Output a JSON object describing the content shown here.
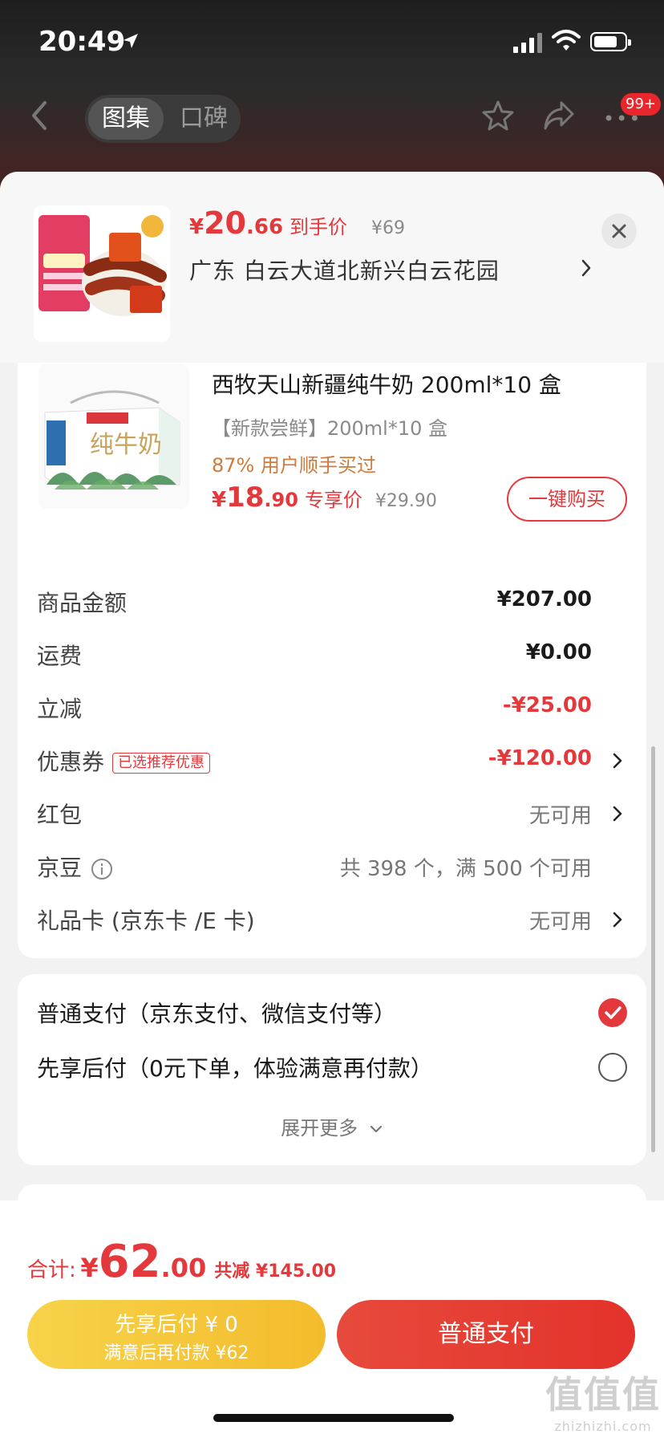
{
  "status_bar": {
    "time": "20:49"
  },
  "nav": {
    "tabs": [
      {
        "label": "图集"
      },
      {
        "label": "口碑"
      }
    ],
    "badge": "99+"
  },
  "sheet_header": {
    "price_currency": "¥",
    "price_int": "20",
    "price_dec": ".66",
    "price_label": "到手价",
    "original_price": "¥69",
    "address": "广东  白云大道北新兴白云花园"
  },
  "product": {
    "title": "西牧天山新疆纯牛奶 200ml*10 盒",
    "spec": "【新款尝鲜】200ml*10 盒",
    "bought_ratio": "87% 用户顺手买过",
    "price_currency": "¥",
    "price_int": "18",
    "price_dec": ".90",
    "price_label": "专享价",
    "original_price": "¥29.90",
    "buy_label": "一键购买"
  },
  "summary": {
    "goods": {
      "label": "商品金额",
      "value": "¥207.00"
    },
    "shipping": {
      "label": "运费",
      "value": "¥0.00"
    },
    "discount": {
      "label": "立减",
      "value": "-¥25.00"
    },
    "coupon": {
      "label": "优惠券",
      "tag": "已选推荐优惠",
      "value": "-¥120.00"
    },
    "red_packet": {
      "label": "红包",
      "value": "无可用"
    },
    "jingdou": {
      "label": "京豆",
      "value": "共 398 个，满 500 个可用"
    },
    "gift_card": {
      "label": "礼品卡 (京东卡 /E 卡)",
      "value": "无可用"
    }
  },
  "payment": {
    "options": [
      {
        "label": "普通支付（京东支付、微信支付等）",
        "selected": true
      },
      {
        "label": "先享后付（0元下单，体验满意再付款）",
        "selected": false
      }
    ],
    "expand_label": "展开更多"
  },
  "bottom": {
    "total_label": "合计:",
    "total_currency": "¥",
    "total_int": "62",
    "total_dec": ".00",
    "total_save": "共减 ¥145.00",
    "btn_later_line1": "先享后付 ¥ 0",
    "btn_later_line2": "满意后再付款 ¥62",
    "btn_normal": "普通支付"
  },
  "watermark": {
    "line1": "值值值",
    "line2": "zhizhizhi.com"
  },
  "colors": {
    "accent": "#e4393c",
    "later_button": "#f5c83a",
    "dark_header": "#1e1e1e"
  }
}
